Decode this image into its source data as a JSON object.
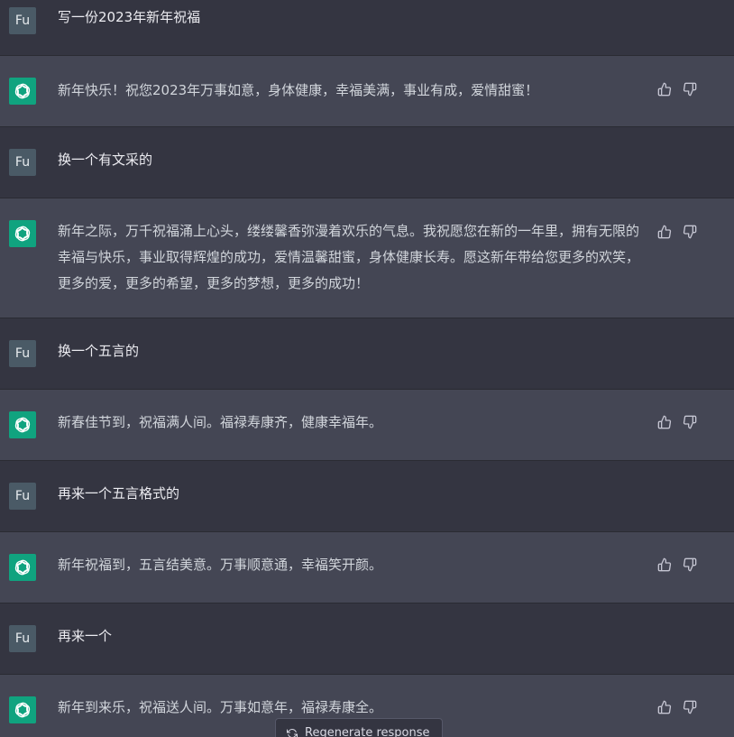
{
  "conversation": [
    {
      "role": "user",
      "avatar": "Fu",
      "text": "写一份2023年新年祝福"
    },
    {
      "role": "assistant",
      "avatar_icon": "openai-logo-icon",
      "text": "新年快乐！祝您2023年万事如意，身体健康，幸福美满，事业有成，爱情甜蜜！"
    },
    {
      "role": "user",
      "avatar": "Fu",
      "text": "换一个有文采的"
    },
    {
      "role": "assistant",
      "avatar_icon": "openai-logo-icon",
      "text": "新年之际，万千祝福涌上心头，缕缕馨香弥漫着欢乐的气息。我祝愿您在新的一年里，拥有无限的幸福与快乐，事业取得辉煌的成功，爱情温馨甜蜜，身体健康长寿。愿这新年带给您更多的欢笑，更多的爱，更多的希望，更多的梦想，更多的成功！"
    },
    {
      "role": "user",
      "avatar": "Fu",
      "text": "换一个五言的"
    },
    {
      "role": "assistant",
      "avatar_icon": "openai-logo-icon",
      "text": "新春佳节到，祝福满人间。福禄寿康齐，健康幸福年。"
    },
    {
      "role": "user",
      "avatar": "Fu",
      "text": "再来一个五言格式的"
    },
    {
      "role": "assistant",
      "avatar_icon": "openai-logo-icon",
      "text": "新年祝福到，五言结美意。万事顺意通，幸福笑开颜。"
    },
    {
      "role": "user",
      "avatar": "Fu",
      "text": "再来一个"
    },
    {
      "role": "assistant",
      "avatar_icon": "openai-logo-icon",
      "text": "新年到来乐，祝福送人间。万事如意年，福禄寿康全。"
    }
  ],
  "feedback_icons": {
    "up": "thumbs-up-icon",
    "down": "thumbs-down-icon"
  },
  "regenerate": {
    "icon": "refresh-icon",
    "label": "Regenerate response"
  },
  "colors": {
    "user_bg": "#343541",
    "assistant_bg": "#444654",
    "bot_avatar": "#10a37f",
    "user_avatar": "#4a5a66"
  }
}
